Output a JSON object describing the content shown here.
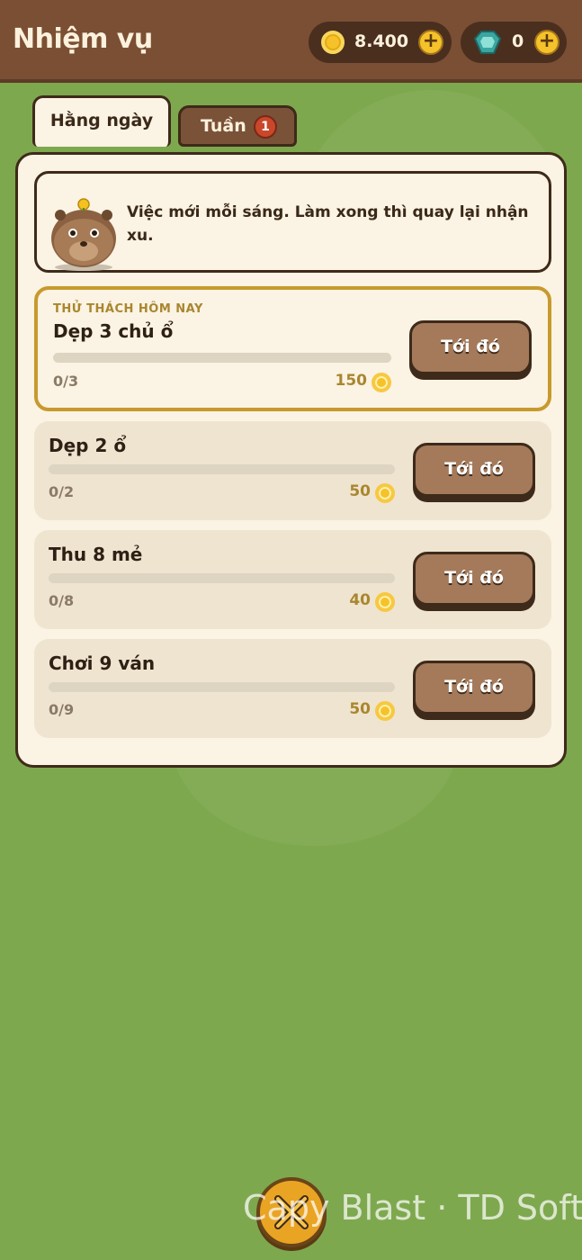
{
  "header": {
    "title": "Nhiệm vụ",
    "coins": "8.400",
    "gems": "0",
    "add_label": "+"
  },
  "tabs": [
    {
      "label": "Hằng ngày",
      "active": true
    },
    {
      "label": "Tuần",
      "badge": "1",
      "active": false
    }
  ],
  "intro": {
    "text": "Việc mới mỗi sáng. Làm xong thì quay lại nhận xu."
  },
  "featured": {
    "tag": "THỬ THÁCH HÔM NAY",
    "title": "Dẹp 3 chủ ổ",
    "progress": "0/3",
    "progress_fraction": 0,
    "reward": "150",
    "button": "Tới đó"
  },
  "quests": [
    {
      "title": "Dẹp 2 ổ",
      "progress": "0/2",
      "progress_fraction": 0,
      "reward": "50",
      "button": "Tới đó"
    },
    {
      "title": "Thu 8 mẻ",
      "progress": "0/8",
      "progress_fraction": 0,
      "reward": "40",
      "button": "Tới đó"
    },
    {
      "title": "Chơi 9 ván",
      "progress": "0/9",
      "progress_fraction": 0,
      "reward": "50",
      "button": "Tới đó"
    }
  ],
  "watermark": "Capy Blast · TD Soft",
  "colors": {
    "header_bg": "#7b4f34",
    "background": "#7ea84e",
    "panel_bg": "#fbf3e3",
    "accent_gold": "#c79a2e",
    "button_brown": "#a47a5a"
  },
  "icons": [
    "coin-icon",
    "gem-icon",
    "plus-icon",
    "mascot-capybara",
    "close-icon"
  ]
}
